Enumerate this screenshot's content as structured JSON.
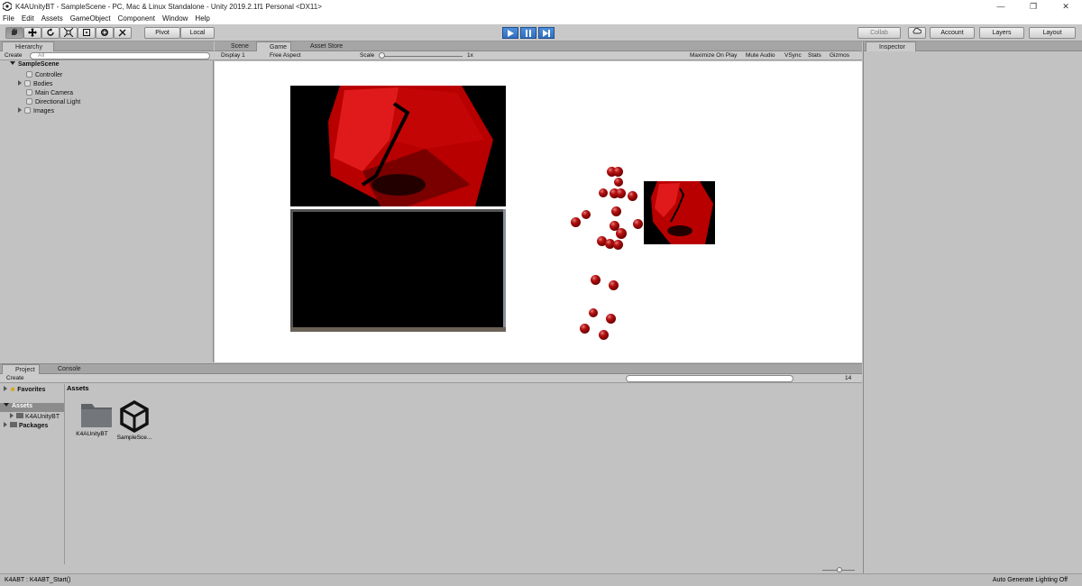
{
  "window": {
    "title": "K4AUnityBT - SampleScene - PC, Mac & Linux Standalone - Unity 2019.2.1f1 Personal <DX11>",
    "minimize": "—",
    "restore": "❐",
    "close": "✕"
  },
  "menu": [
    "File",
    "Edit",
    "Assets",
    "GameObject",
    "Component",
    "Window",
    "Help"
  ],
  "toolbar": {
    "pivot": "Pivot",
    "local": "Local",
    "collab": "Collab",
    "account": "Account",
    "layers": "Layers",
    "layout": "Layout"
  },
  "hierarchy": {
    "tab": "Hierarchy",
    "create": "Create",
    "search_placeholder": "All",
    "scene": "SampleScene",
    "items": [
      "Controller",
      "Bodies",
      "Main Camera",
      "Directional Light",
      "Images"
    ]
  },
  "center_tabs": [
    "Scene",
    "Game",
    "Asset Store"
  ],
  "game_toolbar": {
    "display": "Display 1",
    "aspect": "Free Aspect",
    "scale_label": "Scale",
    "scale_value": "1x",
    "maximize": "Maximize On Play",
    "mute": "Mute Audio",
    "vsync": "VSync",
    "stats": "Stats",
    "gizmos": "Gizmos"
  },
  "inspector": {
    "tab": "Inspector"
  },
  "bottom_tabs": [
    "Project",
    "Console"
  ],
  "project": {
    "create": "Create",
    "favorites": "Favorites",
    "assets": "Assets",
    "assets_child": "K4AUnityBT",
    "packages": "Packages",
    "breadcrumb": "Assets",
    "hidden_count": "14",
    "files": [
      "K4AUnityBT",
      "SampleSce..."
    ]
  },
  "status": {
    "message": "K4ABT : K4ABT_Start()",
    "right": "Auto Generate Lighting Off"
  },
  "colors": {
    "play_blue": "#2f6fc0",
    "sphere_red": "#b81010"
  },
  "icons": {
    "play": "play-icon",
    "pause": "pause-icon",
    "step": "step-icon"
  }
}
